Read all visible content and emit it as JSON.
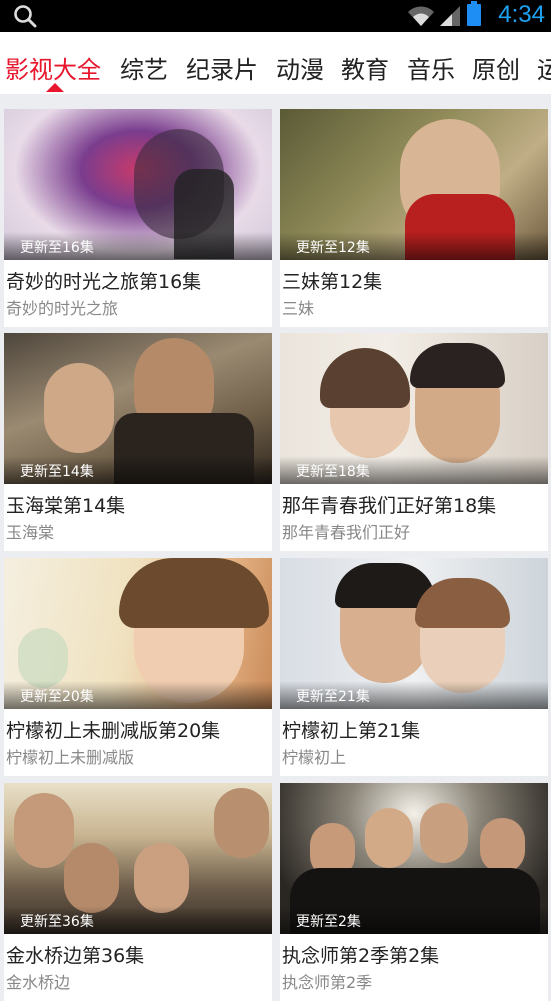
{
  "status_bar": {
    "time": "4:34",
    "icons": [
      "search-icon",
      "wifi-icon",
      "signal-icon",
      "battery-icon"
    ]
  },
  "tabs": [
    "影视大全",
    "综艺",
    "纪录片",
    "动漫",
    "教育",
    "音乐",
    "原创",
    "运"
  ],
  "active_tab": "影视大全",
  "colors": {
    "accent": "#e8162c",
    "time": "#1ea3f3"
  },
  "videos": [
    {
      "badge": "更新至16集",
      "title": "奇妙的时光之旅第16集",
      "subtitle": "奇妙的时光之旅"
    },
    {
      "badge": "更新至12集",
      "title": "三妹第12集",
      "subtitle": "三妹"
    },
    {
      "badge": "更新至14集",
      "title": "玉海棠第14集",
      "subtitle": "玉海棠"
    },
    {
      "badge": "更新至18集",
      "title": "那年青春我们正好第18集",
      "subtitle": "那年青春我们正好"
    },
    {
      "badge": "更新至20集",
      "title": "柠檬初上未删减版第20集",
      "subtitle": "柠檬初上未删减版"
    },
    {
      "badge": "更新至21集",
      "title": "柠檬初上第21集",
      "subtitle": "柠檬初上"
    },
    {
      "badge": "更新至36集",
      "title": "金水桥边第36集",
      "subtitle": "金水桥边"
    },
    {
      "badge": "更新至2集",
      "title": "执念师第2季第2集",
      "subtitle": "执念师第2季"
    }
  ]
}
